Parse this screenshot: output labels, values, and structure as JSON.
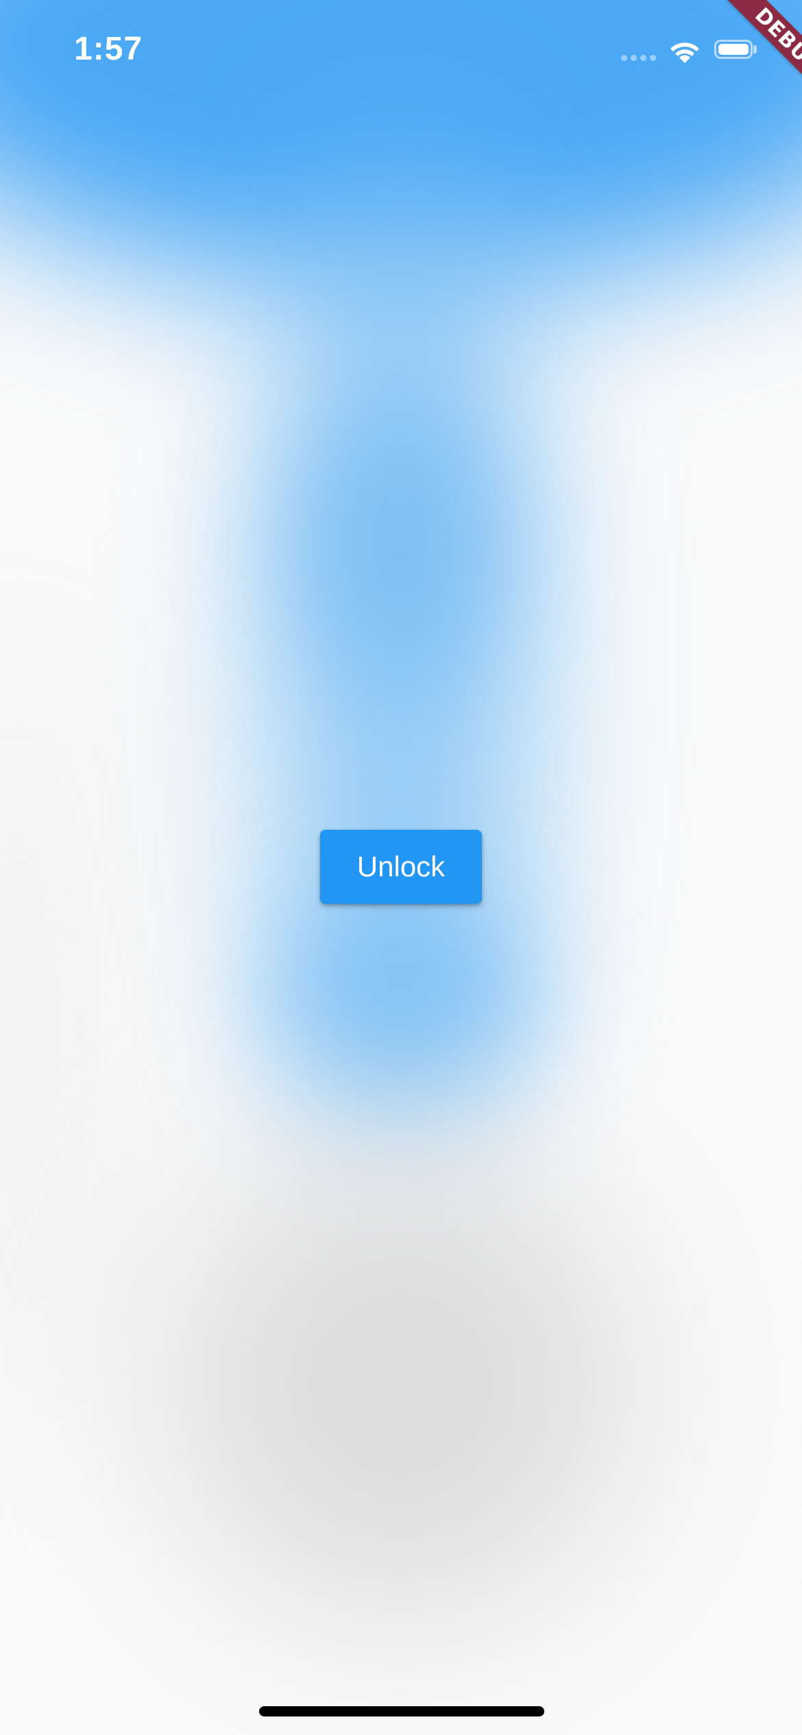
{
  "status_bar": {
    "time": "1:57",
    "signal_icon": "cellular-signal-icon",
    "wifi_icon": "wifi-icon",
    "battery_icon": "battery-icon"
  },
  "debug_banner": {
    "label": "DEBUG",
    "color": "#8a2b43"
  },
  "main": {
    "unlock_label": "Unlock",
    "accent_color": "#2196f3"
  }
}
